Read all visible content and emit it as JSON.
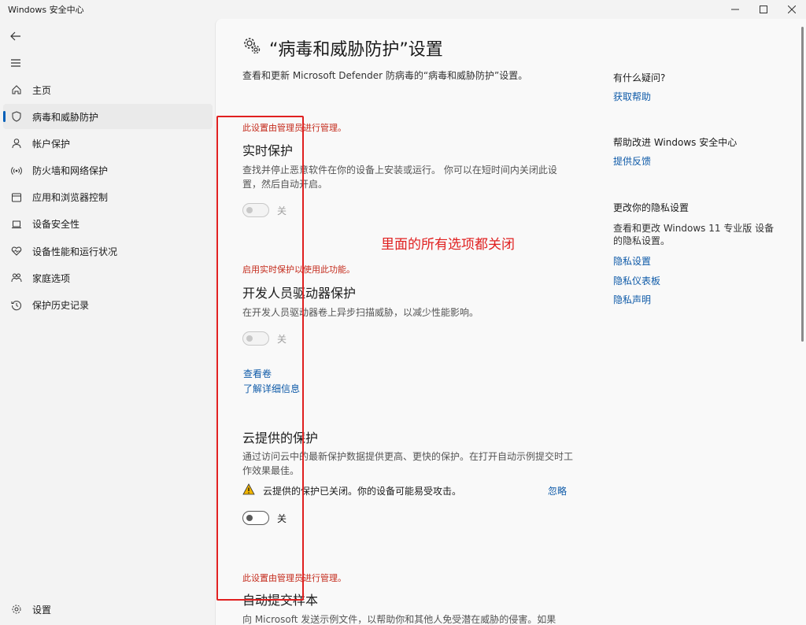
{
  "window": {
    "title": "Windows 安全中心",
    "controls": [
      "minimize-icon",
      "maximize-icon",
      "close-icon"
    ]
  },
  "sidebar": {
    "back_icon": "arrow-left-icon",
    "menu_icon": "hamburger-icon",
    "items": [
      {
        "label": "主页",
        "icon": "home-icon",
        "active": false
      },
      {
        "label": "病毒和威胁防护",
        "icon": "shield-icon",
        "active": true
      },
      {
        "label": "帐户保护",
        "icon": "person-icon",
        "active": false
      },
      {
        "label": "防火墙和网络保护",
        "icon": "wireless-icon",
        "active": false
      },
      {
        "label": "应用和浏览器控制",
        "icon": "browser-window-icon",
        "active": false
      },
      {
        "label": "设备安全性",
        "icon": "laptop-icon",
        "active": false
      },
      {
        "label": "设备性能和运行状况",
        "icon": "heart-pulse-icon",
        "active": false
      },
      {
        "label": "家庭选项",
        "icon": "family-icon",
        "active": false
      },
      {
        "label": "保护历史记录",
        "icon": "history-icon",
        "active": false
      }
    ],
    "settings_label": "设置"
  },
  "main": {
    "title": "“病毒和威胁防护”设置",
    "description": "查看和更新 Microsoft Defender 防病毒的“病毒和威胁防护”设置。",
    "sections": {
      "realtime": {
        "admin_note": "此设置由管理员进行管理。",
        "title": "实时保护",
        "description": "查找并停止恶意软件在你的设备上安装或运行。 你可以在短时间内关闭此设置，然后自动开启。",
        "toggle_state": "关",
        "enabled": false
      },
      "devdrive": {
        "admin_note": "启用实时保护以使用此功能。",
        "title": "开发人员驱动器保护",
        "description": "在开发人员驱动器卷上异步扫描威胁，以减少性能影响。",
        "toggle_state": "关",
        "enabled": false,
        "link_view_volumes": "查看卷",
        "link_learn_more": "了解详细信息"
      },
      "cloud": {
        "title": "云提供的保护",
        "description": "通过访问云中的最新保护数据提供更高、更快的保护。在打开自动示例提交时工作效果最佳。",
        "warning": "云提供的保护已关闭。你的设备可能易受攻击。",
        "dismiss": "忽略",
        "toggle_state": "关",
        "enabled": true
      },
      "sample": {
        "admin_note": "此设置由管理员进行管理。",
        "title": "自动提交样本",
        "description": "向 Microsoft 发送示例文件，以帮助你和其他人免受潜在威胁的侵害。如果"
      }
    },
    "annotation": "里面的所有选项都关闭"
  },
  "right_column": {
    "help_heading": "有什么疑问?",
    "help_link": "获取帮助",
    "improve_heading": "帮助改进 Windows 安全中心",
    "improve_link": "提供反馈",
    "privacy_heading": "更改你的隐私设置",
    "privacy_text": "查看和更改 Windows 11 专业版 设备的隐私设置。",
    "privacy_links": [
      "隐私设置",
      "隐私仪表板",
      "隐私声明"
    ]
  },
  "colors": {
    "accent": "#005fb8",
    "link": "#0e5aa8",
    "admin_note": "#c42b1c",
    "annotation": "#e02020",
    "warning": "#f0b400"
  }
}
